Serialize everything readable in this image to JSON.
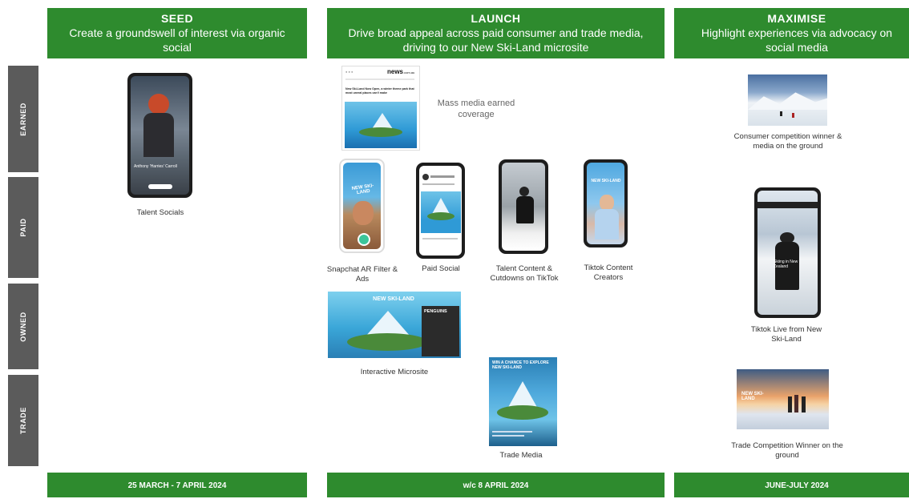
{
  "phases": [
    {
      "title": "SEED",
      "description": "Create a groundswell of interest via organic social",
      "dates": "25 MARCH - 7 APRIL 2024"
    },
    {
      "title": "LAUNCH",
      "description": "Drive broad appeal across paid consumer and trade media, driving to our New Ski-Land microsite",
      "dates": "w/c 8 APRIL 2024"
    },
    {
      "title": "MAXIMISE",
      "description": "Highlight experiences via advocacy on social media",
      "dates": "JUNE-JULY 2024"
    }
  ],
  "rows": [
    "EARNED",
    "PAID",
    "OWNED",
    "TRADE"
  ],
  "seed": {
    "talent_socials": {
      "caption": "Talent Socials",
      "name_overlay": "Anthony 'Harries' Carroll"
    }
  },
  "launch": {
    "mass_media": {
      "caption": "Mass media earned coverage",
      "site_logo": "news",
      "site_suffix": ".com.au",
      "headline": "New Ski-Land Now Open, a winter theme park that most unreal places can't make"
    },
    "snapchat": {
      "caption": "Snapchat AR Filter & Ads"
    },
    "paid_social": {
      "caption": "Paid Social"
    },
    "talent_tiktok": {
      "caption": "Talent Content & Cutdowns on TikTok"
    },
    "tiktok_creators": {
      "caption": "Tiktok Content Creators"
    },
    "microsite": {
      "caption": "Interactive Microsite",
      "badge": "PENGUINS"
    },
    "trade_media": {
      "caption": "Trade Media",
      "headline": "WIN A CHANCE TO EXPLORE NEW SKI-LAND"
    }
  },
  "maximise": {
    "consumer_comp": {
      "caption": "Consumer competition winner & media on the ground"
    },
    "tiktok_live": {
      "caption": "Tiktok Live from New Ski-Land",
      "overlay": "Skiing in New Zealand"
    },
    "trade_comp": {
      "caption": "Trade Competition Winner on the ground"
    }
  },
  "brand_logo": "NEW SKI-LAND",
  "colors": {
    "green": "#2e8b2e",
    "row_gray": "#5b5b5b"
  }
}
